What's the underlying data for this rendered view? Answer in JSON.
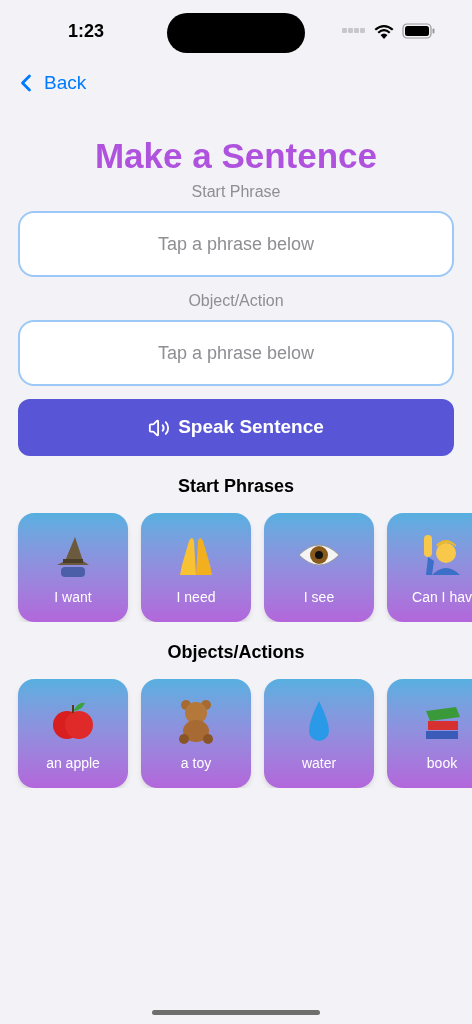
{
  "status_bar": {
    "time": "1:23"
  },
  "nav": {
    "back": "Back"
  },
  "title": "Make a Sentence",
  "fields": [
    {
      "label": "Start Phrase",
      "placeholder": "Tap a phrase below"
    },
    {
      "label": "Object/Action",
      "placeholder": "Tap a phrase below"
    }
  ],
  "speak_button": "Speak Sentence",
  "sections": [
    {
      "title": "Start Phrases",
      "cards": [
        {
          "label": "I want"
        },
        {
          "label": "I need"
        },
        {
          "label": "I see"
        },
        {
          "label": "Can I hav"
        }
      ]
    },
    {
      "title": "Objects/Actions",
      "cards": [
        {
          "label": "an apple"
        },
        {
          "label": "a toy"
        },
        {
          "label": "water"
        },
        {
          "label": "book"
        }
      ]
    }
  ]
}
